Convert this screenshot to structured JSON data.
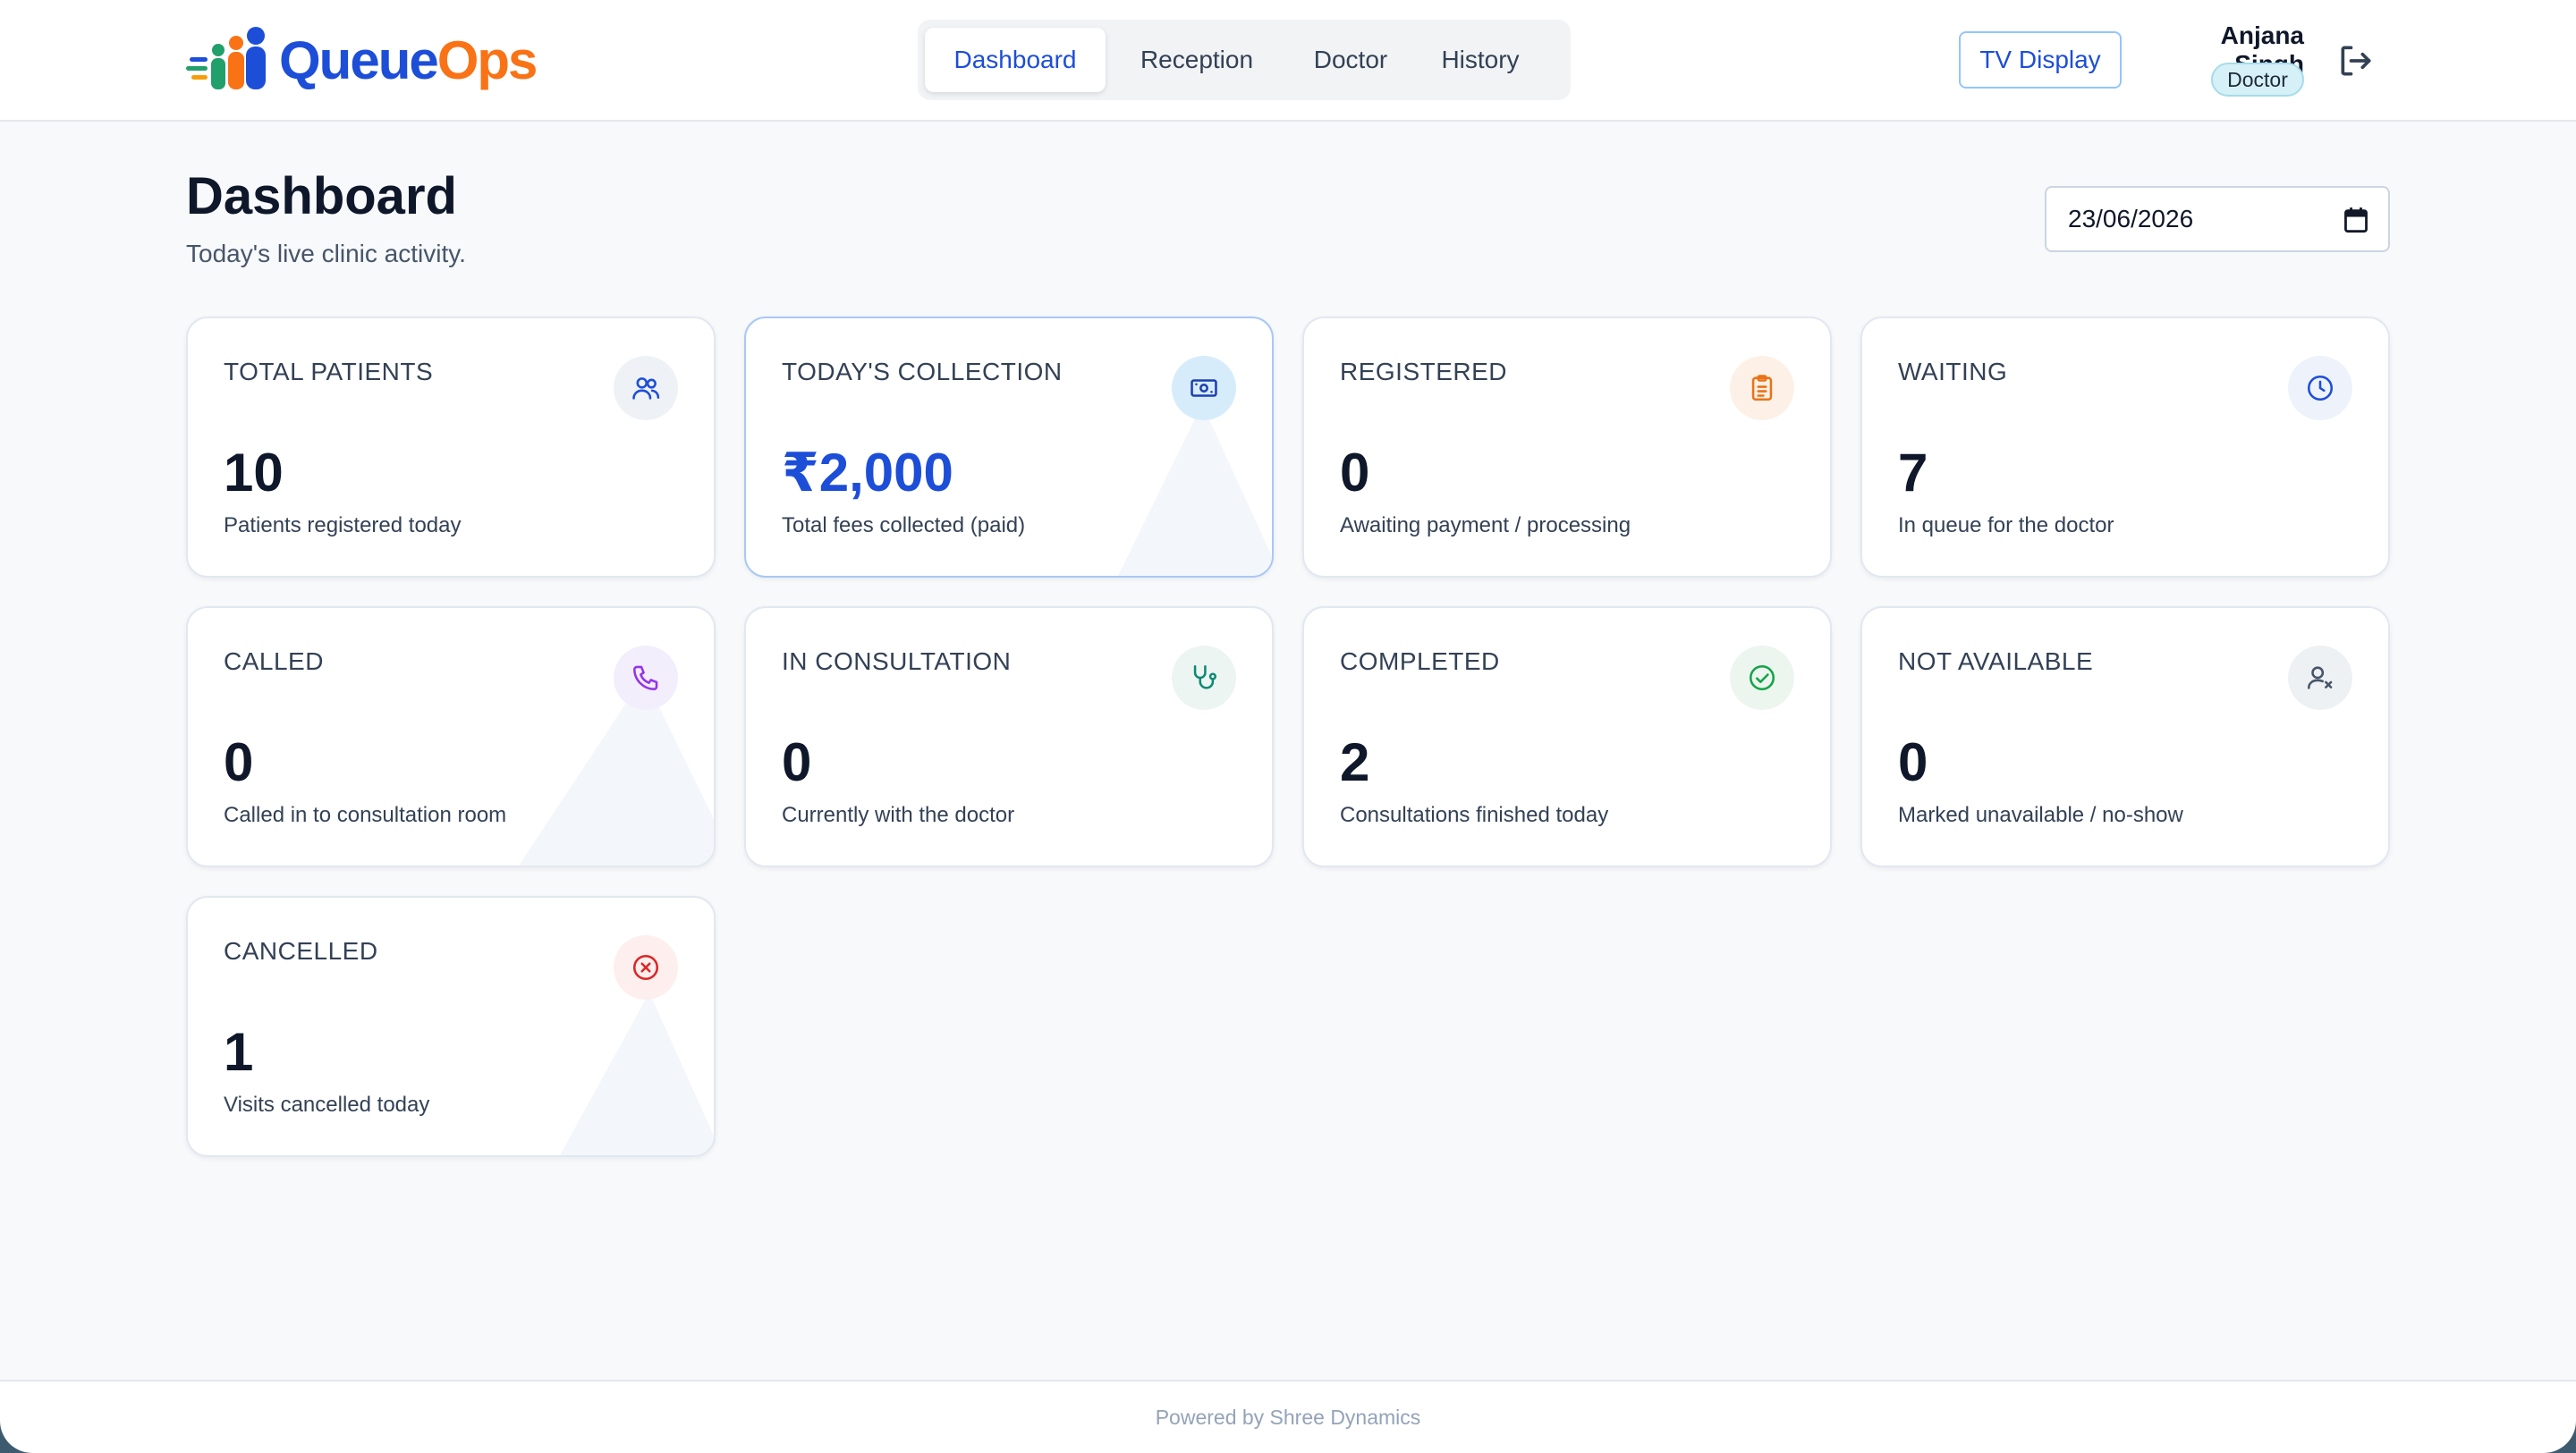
{
  "app": {
    "logo_part1": "Queue",
    "logo_part2": "Ops"
  },
  "nav": {
    "tabs": [
      {
        "label": "Dashboard",
        "active": true
      },
      {
        "label": "Reception",
        "active": false
      },
      {
        "label": "Doctor",
        "active": false
      },
      {
        "label": "History",
        "active": false
      }
    ]
  },
  "header": {
    "tv_display_label": "TV Display",
    "user_name": "Anjana Singh",
    "user_role": "Doctor",
    "logout_icon": "logout-icon"
  },
  "page": {
    "title": "Dashboard",
    "subtitle": "Today's live clinic activity.",
    "date_value": "23/06/2026"
  },
  "cards": [
    {
      "label": "TOTAL PATIENTS",
      "value": "10",
      "desc": "Patients registered today",
      "icon": "users-icon",
      "color": "#1d4ed8",
      "bg": "#eef2f7"
    },
    {
      "label": "TODAY'S COLLECTION",
      "value": "₹2,000",
      "desc": "Total fees collected (paid)",
      "icon": "cash-icon",
      "color": "#1e40af",
      "bg": "#d6ecfb"
    },
    {
      "label": "REGISTERED",
      "value": "0",
      "desc": "Awaiting payment / processing",
      "icon": "clipboard-icon",
      "color": "#ea7317",
      "bg": "#fdf1e7"
    },
    {
      "label": "WAITING",
      "value": "7",
      "desc": "In queue for the doctor",
      "icon": "clock-icon",
      "color": "#1d4ed8",
      "bg": "#eef3fb"
    },
    {
      "label": "CALLED",
      "value": "0",
      "desc": "Called in to consultation room",
      "icon": "phone-icon",
      "color": "#9333ea",
      "bg": "#f3eefb"
    },
    {
      "label": "IN CONSULTATION",
      "value": "0",
      "desc": "Currently with the doctor",
      "icon": "stethoscope-icon",
      "color": "#0f8a73",
      "bg": "#ecf5f2"
    },
    {
      "label": "COMPLETED",
      "value": "2",
      "desc": "Consultations finished today",
      "icon": "check-circle-icon",
      "color": "#16a34a",
      "bg": "#ecf6ef"
    },
    {
      "label": "NOT AVAILABLE",
      "value": "0",
      "desc": "Marked unavailable / no-show",
      "icon": "user-x-icon",
      "color": "#475569",
      "bg": "#eef1f4"
    },
    {
      "label": "CANCELLED",
      "value": "1",
      "desc": "Visits cancelled today",
      "icon": "x-circle-icon",
      "color": "#dc2626",
      "bg": "#fcefed"
    }
  ],
  "footer": {
    "text": "Powered by Shree Dynamics"
  }
}
